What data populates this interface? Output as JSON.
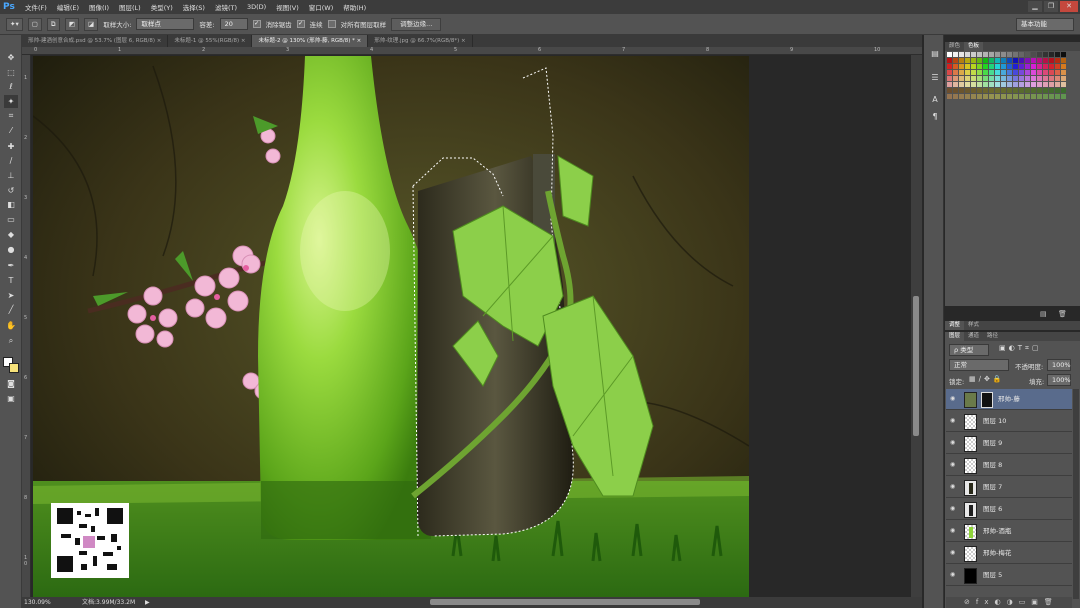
{
  "app": {
    "logo": "Ps"
  },
  "menu": [
    "文件(F)",
    "编辑(E)",
    "图像(I)",
    "图层(L)",
    "类型(Y)",
    "选择(S)",
    "滤镜(T)",
    "3D(D)",
    "视图(V)",
    "窗口(W)",
    "帮助(H)"
  ],
  "window_controls": {
    "minimize": "▁",
    "restore": "❐",
    "close": "✕"
  },
  "options": {
    "sample_size_label": "取样大小:",
    "sample_size_value": "取样点",
    "tolerance_label": "容差:",
    "tolerance_value": "20",
    "antialias_label": "消除锯齿",
    "contiguous_label": "连续",
    "sample_all_label": "对所有图层取样",
    "refine_edge_label": "调整边缘...",
    "workspace": "基本功能"
  },
  "tabs": [
    {
      "label": "邢帅-建酒创意合成.psd @ 53.7% (图层 6, RGB/8)",
      "close": "×"
    },
    {
      "label": "未标题-1 @ 55%(RGB/8)",
      "close": "×"
    },
    {
      "label": "未标题-2 @ 130% (邢帅-藤, RGB/8) *",
      "close": "×"
    },
    {
      "label": "邢帅-纹理.jpg @ 66.7%(RGB/8*)",
      "close": "×"
    }
  ],
  "active_tab": 2,
  "status": {
    "zoom": "130.09%",
    "doc": "文档:3.99M/33.2M",
    "arrow": "▶"
  },
  "ruler": {
    "top": [
      "0",
      "1",
      "2",
      "3",
      "4",
      "5",
      "6",
      "7",
      "8",
      "9",
      "10"
    ],
    "left": [
      "1",
      "2",
      "3",
      "4",
      "5",
      "6",
      "7",
      "8",
      "1 0"
    ]
  },
  "panels": {
    "swatch_tabs": [
      "颜色",
      "色板"
    ],
    "adjust_tabs": [
      "调整",
      "样式"
    ],
    "layer_tabs": [
      "图层",
      "通道",
      "路径"
    ],
    "filter_kind": "ρ 类型",
    "blend_mode": "正常",
    "opacity_label": "不透明度:",
    "opacity_value": "100%",
    "lock_label": "锁定:",
    "fill_label": "填充:",
    "fill_value": "100%"
  },
  "layers": [
    {
      "name": "邢帅-藤",
      "selected": true
    },
    {
      "name": "图层 10",
      "selected": false
    },
    {
      "name": "图层 9",
      "selected": false
    },
    {
      "name": "图层 8",
      "selected": false
    },
    {
      "name": "图层 7",
      "selected": false
    },
    {
      "name": "图层 6",
      "selected": false
    },
    {
      "name": "邢帅-酒瓶",
      "selected": false
    },
    {
      "name": "邢帅-梅花",
      "selected": false
    },
    {
      "name": "图层 5",
      "selected": false
    }
  ],
  "colors": {
    "accent": "#4aa8ff",
    "selected_layer": "#596b8c",
    "bottle": "#8fd43a",
    "grass": "#3f8a1f"
  },
  "tools": [
    "move-icon",
    "marquee-icon",
    "lasso-icon",
    "magic-wand-icon",
    "crop-icon",
    "eyedropper-icon",
    "healing-icon",
    "brush-icon",
    "clone-stamp-icon",
    "history-brush-icon",
    "eraser-icon",
    "gradient-icon",
    "blur-icon",
    "dodge-icon",
    "pen-icon",
    "type-icon",
    "path-select-icon",
    "shape-icon",
    "hand-icon",
    "zoom-icon"
  ]
}
